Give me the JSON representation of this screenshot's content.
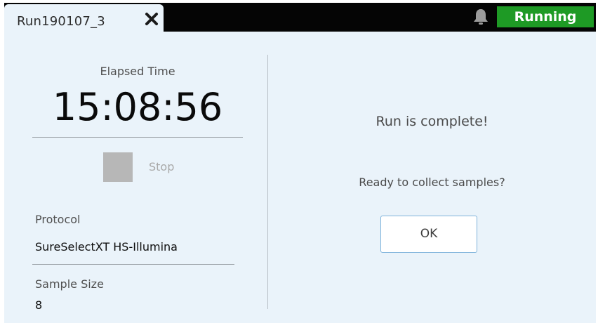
{
  "header": {
    "tab_title": "Run190107_3",
    "status": "Running",
    "status_color": "#1e9a25",
    "close_icon": "close-icon",
    "notification_icon": "bell-icon"
  },
  "left_panel": {
    "elapsed_label": "Elapsed Time",
    "elapsed_time": "15:08:56",
    "stop_label": "Stop",
    "protocol_label": "Protocol",
    "protocol_value": "SureSelectXT HS-Illumina",
    "sample_size_label": "Sample Size",
    "sample_size_value": "8"
  },
  "dialog": {
    "message": "Run is complete!",
    "question": "Ready to collect samples?",
    "ok_label": "OK"
  }
}
